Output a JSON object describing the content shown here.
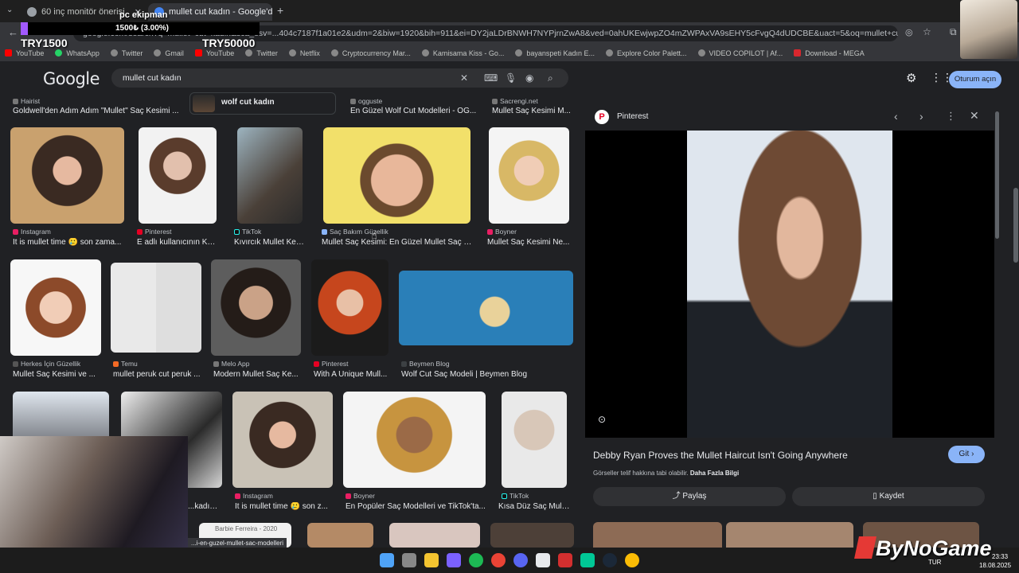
{
  "browser": {
    "tabs": [
      {
        "label": "60 inç monitör önerisi",
        "active": false
      },
      {
        "label": "mullet cut kadın - Google'da A",
        "active": true
      }
    ],
    "new_tab": "+",
    "url": "google.com/search?q=mullet+cut+kadin&sca_esv=...404c7187f1a01e2&udm=2&biw=1920&bih=911&ei=DY2jaLDrBNWH7NYPjrnZwA8&ved=0ahUKEwjwpZO4mZWPAxVA9sEHY5cFvgQ4dUDCBE&uact=5&oq=mullet+cut+kadin&gs_lp=EgNpb...",
    "bookmarks": [
      "YouTube",
      "WhatsApp",
      "Twitter",
      "Gmail",
      "YouTube",
      "Twitter",
      "Netflix",
      "Cryptocurrency Mar...",
      "Kamisama Kiss - Go...",
      "bayanspeti Kadın E...",
      "Explore Color Palett...",
      "VIDEO COPILOT | Af...",
      "Download - MEGA"
    ]
  },
  "stream_overlay": {
    "donation_top": "pc ekipman",
    "progress": "1500₺ (3.00%)",
    "try_small": "TRY1500",
    "try_big": "TRY50000",
    "watermark": "ByNoGame",
    "clock_time": "23:33",
    "clock_date": "18.08.2025",
    "lang": "TUR"
  },
  "google": {
    "logo": "Google",
    "query": "mullet cut kadın",
    "signin": "Oturum açın"
  },
  "top_row": [
    {
      "source": "Hairist",
      "title": "Goldwell'den Adım Adım \"Mullet\" Saç Kesimi ..."
    },
    {
      "source": "",
      "title": "wolf cut kadın"
    },
    {
      "source": "ogguste",
      "title": "En Güzel Wolf Cut Modelleri - OG..."
    },
    {
      "source": "Sacrengi.net",
      "title": "Mullet Saç Kesimi M..."
    }
  ],
  "row1": [
    {
      "source": "Instagram",
      "title": "It is mullet time 🥲 son zama..."
    },
    {
      "source": "Pinterest",
      "title": "E adlı kullanıcının Kri..."
    },
    {
      "source": "TikTok",
      "title": "Kıvırcık Mullet Kes..."
    },
    {
      "source": "Saç Bakım Güzellik",
      "title": "Mullet Saç Kesimi: En Güzel Mullet Saç M..."
    },
    {
      "source": "Boyner",
      "title": "Mullet Saç Kesimi Ne..."
    }
  ],
  "row2": [
    {
      "source": "Herkes İçin Güzellik",
      "title": "Mullet Saç Kesimi ve ..."
    },
    {
      "source": "Temu",
      "title": "mullet peruk cut peruk ..."
    },
    {
      "source": "Melo App",
      "title": "Modern Mullet Saç Ke..."
    },
    {
      "source": "Pinterest",
      "title": "With A Unique Mull..."
    },
    {
      "source": "Beymen Blog",
      "title": "Wolf Cut Saç Modeli | Beymen Blog"
    }
  ],
  "row3": [
    {
      "source": "",
      "title": "...kadın |..."
    },
    {
      "source": "Instagram",
      "title": "It is mullet time 🥲 son z..."
    },
    {
      "source": "Boyner",
      "title": "En Popüler Saç Modelleri ve TikTok'ta..."
    },
    {
      "source": "TikTok",
      "title": "Kısa Düz Saç Mull..."
    }
  ],
  "row4_caption": "Barbie Ferreira - 2020",
  "status_url": "...i-en-guzel-mullet-sac-modelleri",
  "panel": {
    "source": "Pinterest",
    "title": "Debby Ryan Proves the Mullet Haircut Isn't Going Anywhere",
    "notice": "Görseller telif hakkına tabi olabilir.",
    "more_info": "Daha Fazla Bilgi",
    "visit": "Git",
    "share": "Paylaş",
    "save": "Kaydet"
  }
}
